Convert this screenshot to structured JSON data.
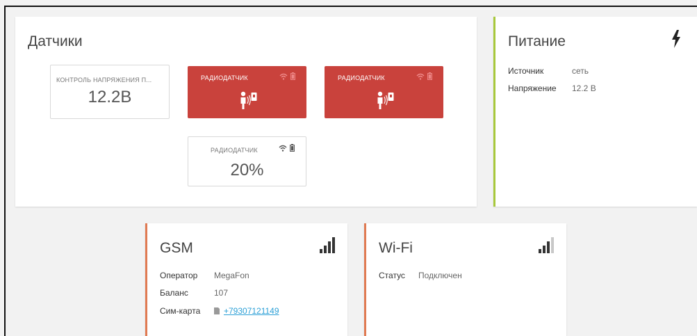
{
  "sensors_card": {
    "title": "Датчики",
    "tiles": [
      {
        "label": "КОНТРОЛЬ НАПРЯЖЕНИЯ П...",
        "value": "12.2В",
        "style": "white"
      },
      {
        "label": "РАДИОДАТЧИК",
        "value": "",
        "style": "red",
        "icon": "person-motion-icon"
      },
      {
        "label": "РАДИОДАТЧИК",
        "value": "",
        "style": "red",
        "icon": "person-motion-icon"
      },
      {
        "label": "РАДИОДАТЧИК",
        "value": "20%",
        "style": "white"
      }
    ]
  },
  "power_card": {
    "title": "Питание",
    "icon": "lightning-icon",
    "source_label": "Источник",
    "source_value": "сеть",
    "voltage_label": "Напряжение",
    "voltage_value": "12.2 В",
    "accent": "#a8c83c"
  },
  "gsm_card": {
    "title": "GSM",
    "icon": "signal-bars-icon",
    "signal_level": 4,
    "operator_label": "Оператор",
    "operator_value": "MegaFon",
    "balance_label": "Баланс",
    "balance_value": "107",
    "sim_label": "Сим-карта",
    "sim_value": "+79307121149",
    "accent": "#e07a52"
  },
  "wifi_card": {
    "title": "Wi-Fi",
    "icon": "signal-bars-icon",
    "signal_level": 3,
    "status_label": "Статус",
    "status_value": "Подключен",
    "accent": "#e07a52"
  },
  "colors": {
    "alarm_red": "#c9423c",
    "link": "#2a9fd6"
  }
}
